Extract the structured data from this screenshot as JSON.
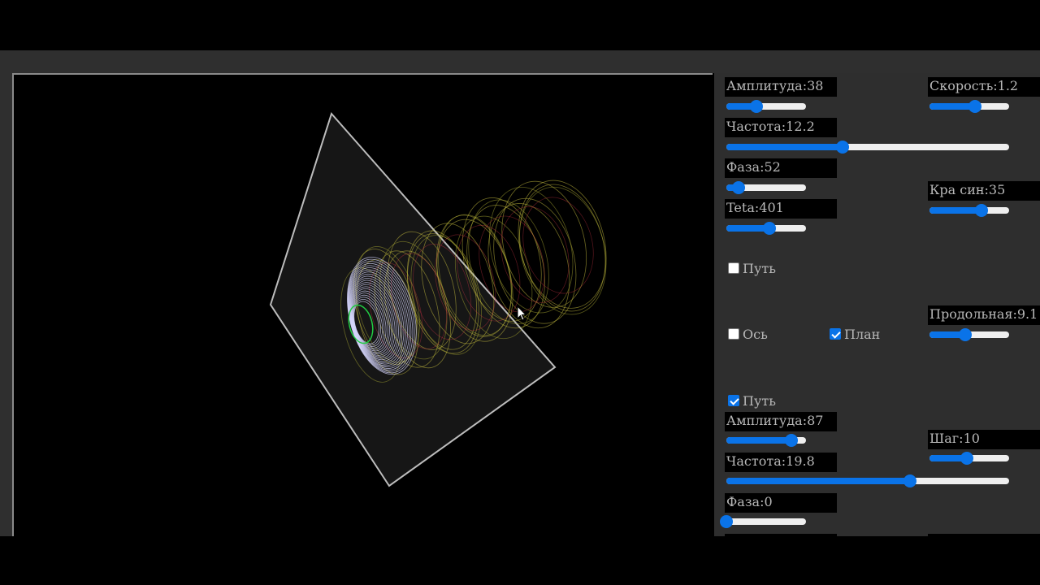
{
  "colors": {
    "accent": "#0a73e8",
    "panel_bg": "#2e2e2e",
    "label_bg": "#000000",
    "track": "#efefef"
  },
  "scene": {
    "plane_icon": "square-frame-icon",
    "helix_colors": [
      "#d8d8ff",
      "#c8c040",
      "#a0a030",
      "#cc3344",
      "#22cc44"
    ]
  },
  "controls": {
    "amplitude1": {
      "label": "Амплитуда:38",
      "value": 0.38
    },
    "speed": {
      "label": "Скорость:1.2",
      "value": 0.57
    },
    "frequency1": {
      "label": "Частота:12.2",
      "value": 0.41
    },
    "phase1": {
      "label": "Фаза:52",
      "value": 0.15
    },
    "teta": {
      "label": "Teta:401",
      "value": 0.54
    },
    "kra_sin": {
      "label": "Кра син:35",
      "value": 0.65
    },
    "path1": {
      "label": "Путь",
      "checked": false
    },
    "axis": {
      "label": "Ось",
      "checked": false
    },
    "plan": {
      "label": "План",
      "checked": true
    },
    "longitudinal": {
      "label": "Продольная:9.1",
      "value": 0.45
    },
    "path2": {
      "label": "Путь",
      "checked": true
    },
    "amplitude2": {
      "label": "Амплитуда:87",
      "value": 0.82
    },
    "step": {
      "label": "Шаг:10",
      "value": 0.47
    },
    "frequency2": {
      "label": "Частота:19.8",
      "value": 0.65
    },
    "phase2": {
      "label": "Фаза:0",
      "value": 0.0
    }
  }
}
